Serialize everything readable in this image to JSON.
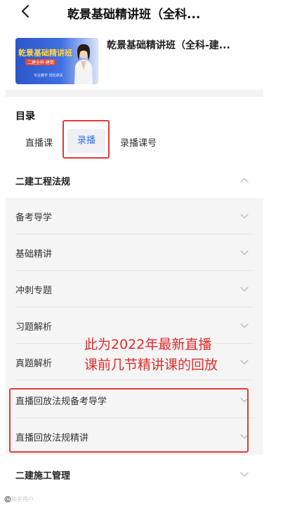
{
  "header": {
    "title": "乾景基础精讲班（全科..."
  },
  "course": {
    "name": "乾景基础精讲班（全科-建...",
    "thumbnail": {
      "brand": "乾景基础精讲班",
      "subtitle": "二建全科·建筑",
      "footer": "专业教学   轻松通关"
    }
  },
  "catalog": {
    "label": "目录",
    "tabs": [
      {
        "label": "直播课"
      },
      {
        "label": "录播"
      },
      {
        "label": "录播课号"
      }
    ],
    "selected_tab": "录播"
  },
  "sections": [
    {
      "title": "二建工程法规",
      "expanded": true,
      "items": [
        {
          "label": "备考导学"
        },
        {
          "label": "基础精讲"
        },
        {
          "label": "冲刺专题"
        },
        {
          "label": "习题解析"
        },
        {
          "label": "真题解析"
        },
        {
          "label": "直播回放法规备考导学"
        },
        {
          "label": "直播回放法规精讲"
        }
      ]
    },
    {
      "title": "二建施工管理",
      "expanded": false
    }
  ],
  "annotation": {
    "line1": "此为2022年最新直播",
    "line2": "课前几节精讲课的回放"
  },
  "watermark": "©️知乎用户",
  "colors": {
    "accent": "#3b6fe0",
    "annotation": "#e02b2b",
    "tab_selected_bg": "#eef0f4"
  }
}
